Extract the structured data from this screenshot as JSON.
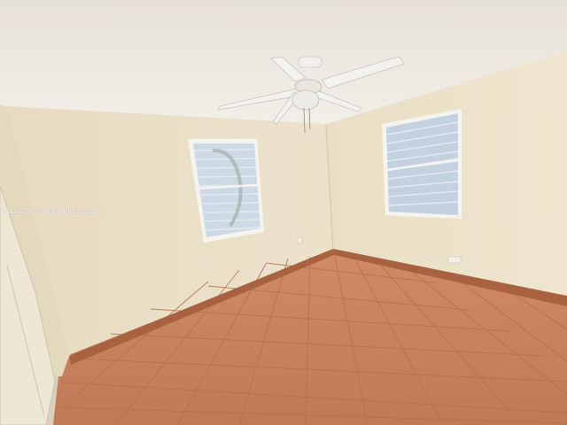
{
  "photo": {
    "subject": "Empty room with ceiling fan, two windows with blinds, and terracotta tile floor",
    "watermark": "A1182741 © Miami MLS® 2025"
  },
  "colors": {
    "ceiling": "#efeae2",
    "left_wall": "#ebdfc6",
    "back_wall": "#e8dcc2",
    "right_wall": "#ede2c9",
    "floor": "#c68260",
    "grout": "#b06e50",
    "baseboard": "#a3603f",
    "window_frame": "#f5f3ee",
    "blind": "#cfdbe6"
  },
  "icons": {
    "fan": "ceiling-fan-icon"
  }
}
